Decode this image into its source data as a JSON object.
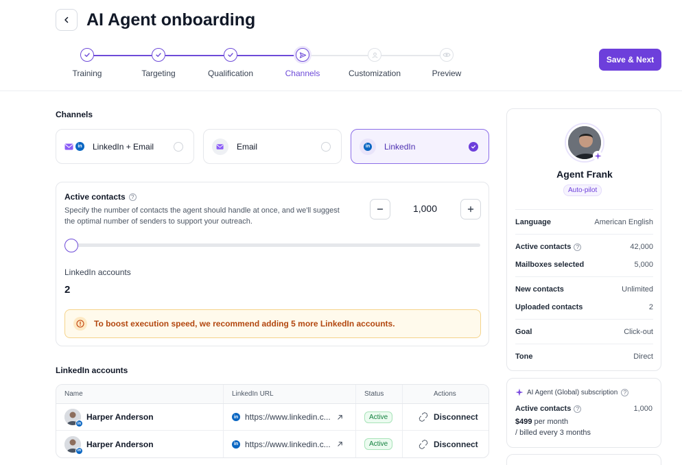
{
  "header": {
    "title": "AI Agent onboarding",
    "save_label": "Save & Next",
    "steps": [
      {
        "label": "Training",
        "state": "done"
      },
      {
        "label": "Targeting",
        "state": "done"
      },
      {
        "label": "Qualification",
        "state": "done"
      },
      {
        "label": "Channels",
        "state": "current"
      },
      {
        "label": "Customization",
        "state": "todo"
      },
      {
        "label": "Preview",
        "state": "todo"
      }
    ]
  },
  "channels": {
    "title": "Channels",
    "options": [
      {
        "label": "LinkedIn + Email",
        "selected": false
      },
      {
        "label": "Email",
        "selected": false
      },
      {
        "label": "LinkedIn",
        "selected": true
      }
    ]
  },
  "contacts": {
    "title": "Active contacts",
    "description": "Specify the number of contacts the agent should handle at once, and we'll suggest the optimal number of senders to support your outreach.",
    "value": "1,000",
    "slider_level": 0,
    "linkedin_accounts_label": "LinkedIn accounts",
    "linkedin_accounts_value": "2",
    "warning": "To boost execution speed, we recommend adding 5 more LinkedIn accounts."
  },
  "accounts_table": {
    "title": "LinkedIn accounts",
    "columns": [
      "Name",
      "LinkedIn URL",
      "Status",
      "Actions"
    ],
    "rows": [
      {
        "name": "Harper Anderson",
        "url": "https://www.linkedin.c...",
        "status": "Active",
        "action": "Disconnect"
      },
      {
        "name": "Harper Anderson",
        "url": "https://www.linkedin.c...",
        "status": "Active",
        "action": "Disconnect"
      }
    ]
  },
  "agent": {
    "name": "Agent Frank",
    "mode": "Auto-pilot",
    "details": [
      {
        "key": "Language",
        "value": "American English"
      },
      {
        "key": "Active contacts",
        "value": "42,000"
      },
      {
        "key": "Mailboxes selected",
        "value": "5,000"
      },
      {
        "key": "New contacts",
        "value": "Unlimited"
      },
      {
        "key": "Uploaded contacts",
        "value": "2"
      },
      {
        "key": "Goal",
        "value": "Click-out"
      },
      {
        "key": "Tone",
        "value": "Direct"
      }
    ]
  },
  "subscription": {
    "title": "AI Agent (Global) subscription",
    "key": "Active contacts",
    "value": "1,000",
    "price": "$499",
    "price_suffix": " per month",
    "billed": "/ billed every 3 months"
  },
  "colors": {
    "accent": "#6d3fdb",
    "linkedin": "#0a66c2",
    "warning": "#b2470f",
    "success": "#12803e"
  }
}
